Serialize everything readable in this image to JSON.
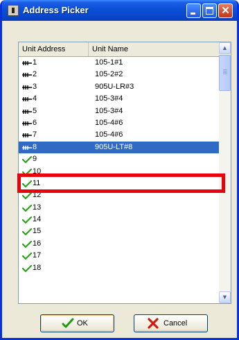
{
  "window": {
    "title": "Address Picker"
  },
  "list": {
    "columns": [
      "Unit Address",
      "Unit Name"
    ],
    "rows": [
      {
        "address": "1",
        "name": "105-1#1",
        "icon": "connector-icon"
      },
      {
        "address": "2",
        "name": "105-2#2",
        "icon": "connector-icon"
      },
      {
        "address": "3",
        "name": "905U-LR#3",
        "icon": "connector-icon"
      },
      {
        "address": "4",
        "name": "105-3#4",
        "icon": "connector-icon"
      },
      {
        "address": "5",
        "name": "105-3#4",
        "icon": "connector-icon"
      },
      {
        "address": "6",
        "name": "105-4#6",
        "icon": "connector-icon"
      },
      {
        "address": "7",
        "name": "105-4#6",
        "icon": "connector-icon"
      },
      {
        "address": "8",
        "name": "905U-LT#8",
        "icon": "connector-icon",
        "selected": true
      },
      {
        "address": "9",
        "name": "",
        "icon": "checkmark-icon"
      },
      {
        "address": "10",
        "name": "",
        "icon": "checkmark-icon"
      },
      {
        "address": "11",
        "name": "",
        "icon": "checkmark-icon"
      },
      {
        "address": "12",
        "name": "",
        "icon": "checkmark-icon"
      },
      {
        "address": "13",
        "name": "",
        "icon": "checkmark-icon"
      },
      {
        "address": "14",
        "name": "",
        "icon": "checkmark-icon"
      },
      {
        "address": "15",
        "name": "",
        "icon": "checkmark-icon"
      },
      {
        "address": "16",
        "name": "",
        "icon": "checkmark-icon"
      },
      {
        "address": "17",
        "name": "",
        "icon": "checkmark-icon"
      },
      {
        "address": "18",
        "name": "",
        "icon": "checkmark-icon"
      }
    ]
  },
  "buttons": {
    "ok_label": "OK",
    "cancel_label": "Cancel"
  },
  "colors": {
    "selection": "#316ac5",
    "highlight_box": "#e8000d",
    "check": "#2aa11a"
  }
}
